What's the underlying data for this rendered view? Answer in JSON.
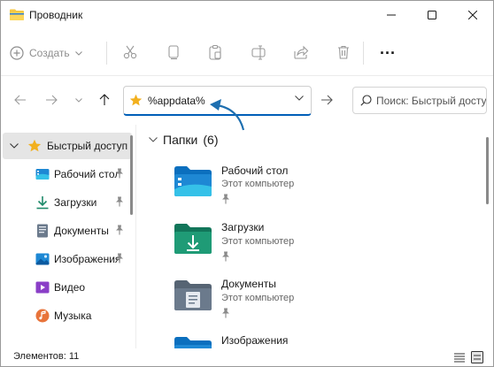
{
  "window": {
    "title": "Проводник"
  },
  "toolbar": {
    "create_label": "Создать",
    "more_label": "..."
  },
  "address": {
    "path": "%appdata%",
    "search_placeholder": "Поиск: Быстрый доступ"
  },
  "sidebar": {
    "items": [
      {
        "label": "Быстрый доступ",
        "icon": "star-icon",
        "pinned": false,
        "selected": true
      },
      {
        "label": "Рабочий стол",
        "icon": "desktop-icon",
        "pinned": true
      },
      {
        "label": "Загрузки",
        "icon": "download-icon",
        "pinned": true
      },
      {
        "label": "Документы",
        "icon": "documents-icon",
        "pinned": true
      },
      {
        "label": "Изображения",
        "icon": "pictures-icon",
        "pinned": true
      },
      {
        "label": "Видео",
        "icon": "video-icon",
        "pinned": false
      },
      {
        "label": "Музыка",
        "icon": "music-icon",
        "pinned": false
      }
    ]
  },
  "content": {
    "group_label": "Папки",
    "group_count": "(6)",
    "folders": [
      {
        "name": "Рабочий стол",
        "location": "Этот компьютер",
        "icon": "desktop-folder-icon"
      },
      {
        "name": "Загрузки",
        "location": "Этот компьютер",
        "icon": "downloads-folder-icon"
      },
      {
        "name": "Документы",
        "location": "Этот компьютер",
        "icon": "documents-folder-icon"
      },
      {
        "name": "Изображения",
        "location": "",
        "icon": "pictures-folder-icon"
      }
    ]
  },
  "status": {
    "items_text": "Элементов: 11"
  },
  "colors": {
    "accent": "#005fb8",
    "folder_blue": "#1e88d4",
    "folder_green": "#1f8a6a",
    "folder_gray": "#6b7a8c",
    "star": "#f2b01e"
  }
}
